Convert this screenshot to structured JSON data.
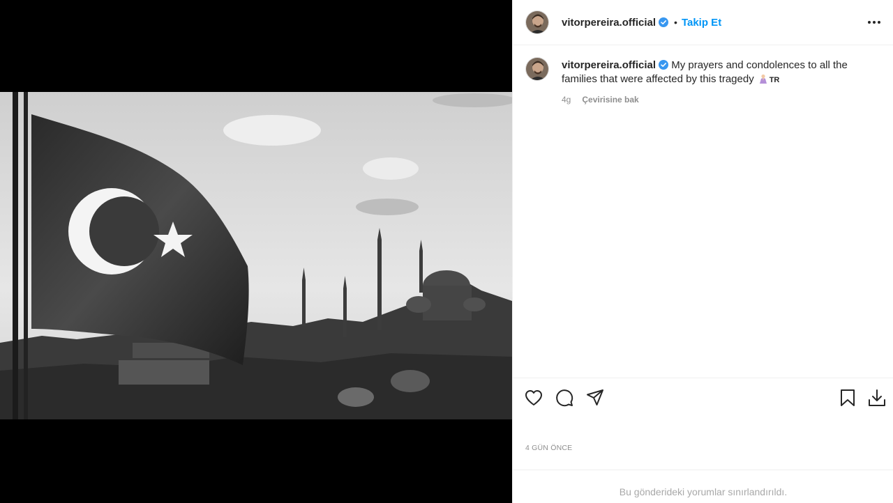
{
  "post": {
    "author": {
      "username": "vitorpereira.official",
      "verified": true,
      "avatar": "avatar-photo"
    },
    "header": {
      "dot": "•",
      "follow_label": "Takip Et",
      "more_icon": "more-horizontal-icon"
    },
    "caption": {
      "username": "vitorpereira.official",
      "text": "My prayers and condolences to all the families that were affected by this tragedy",
      "emoji": "praying-woman-emoji",
      "flag_text": "TR",
      "age": "4g",
      "translate_label": "Çevirisine bak"
    },
    "actions": {
      "like_icon": "heart-icon",
      "comment_icon": "comment-icon",
      "share_icon": "send-icon",
      "save_icon": "bookmark-icon",
      "download_icon": "download-icon"
    },
    "timestamp": "4 GÜN ÖNCE",
    "comments_notice": "Bu gönderideki yorumlar sınırlandırıldı.",
    "colors": {
      "accent": "#0095f6",
      "verified": "#3897f0",
      "text": "#262626",
      "muted": "#8e8e8e"
    }
  }
}
